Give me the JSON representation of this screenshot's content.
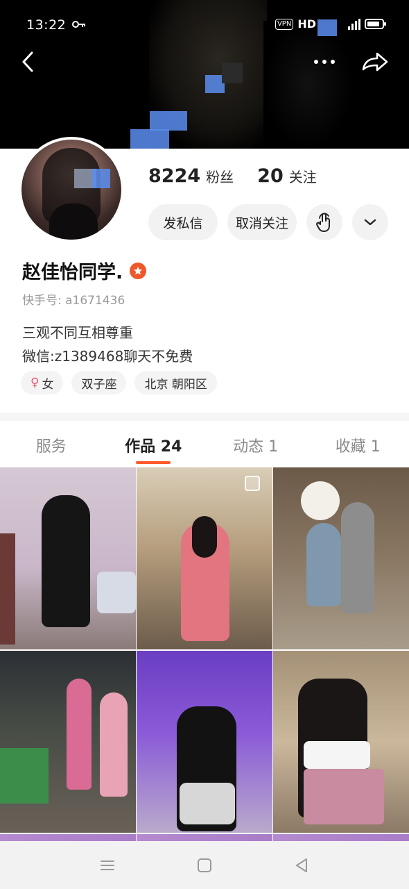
{
  "status_bar": {
    "time": "13:22",
    "vpn": "VPN",
    "network": "HD"
  },
  "profile": {
    "followers_count": "8224",
    "followers_label": "粉丝",
    "following_count": "20",
    "following_label": "关注",
    "name": "赵佳怡同学.",
    "kuaishou_id": "快手号: a1671436",
    "bio_line1": "三观不同互相尊重",
    "bio_line2": "微信:z1389468聊天不免费"
  },
  "actions": {
    "message_label": "发私信",
    "unfollow_label": "取消关注"
  },
  "tags": {
    "gender": "女",
    "zodiac": "双子座",
    "location": "北京 朝阳区"
  },
  "tabs": [
    {
      "label": "服务"
    },
    {
      "label": "作品 24"
    },
    {
      "label": "动态 1"
    },
    {
      "label": "收藏 1"
    }
  ],
  "colors": {
    "accent": "#ff5a2c",
    "badge": "#f0572a",
    "gender_symbol": "#e8536a"
  },
  "icons": [
    "key-icon",
    "back-icon",
    "more-icon",
    "share-icon",
    "touch-icon",
    "chevron-down-icon",
    "star-badge-icon",
    "female-icon",
    "menu-icon",
    "home-icon",
    "nav-back-icon"
  ]
}
